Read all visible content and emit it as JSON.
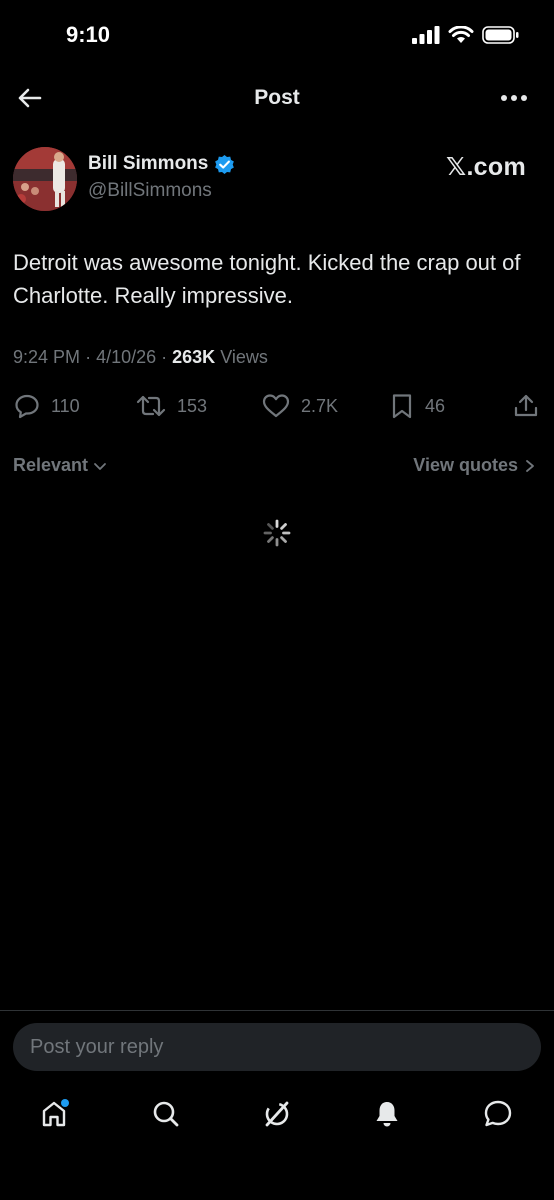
{
  "status_bar": {
    "time": "9:10"
  },
  "header": {
    "title": "Post"
  },
  "author": {
    "name": "Bill Simmons",
    "handle": "@BillSimmons",
    "source": "𝕏.com"
  },
  "tweet": {
    "text": "Detroit was awesome tonight. Kicked the crap out of Charlotte. Really impressive.",
    "time": "9:24 PM",
    "date": "4/10/26",
    "views_count": "263K",
    "views_label": "Views"
  },
  "actions": {
    "replies": "110",
    "reposts": "153",
    "likes": "2.7K",
    "bookmarks": "46"
  },
  "replies_filter": {
    "sort_label": "Relevant",
    "quotes_label": "View quotes"
  },
  "reply_box": {
    "placeholder": "Post your reply"
  },
  "nav": {
    "items": [
      "home-icon",
      "search-icon",
      "grok-icon",
      "notifications-icon",
      "messages-icon"
    ],
    "home_dot_color": "#1d9bf0"
  },
  "colors": {
    "background": "#000000",
    "text": "#e7e9ea",
    "secondary": "#71767b",
    "verified": "#1d9bf0"
  }
}
